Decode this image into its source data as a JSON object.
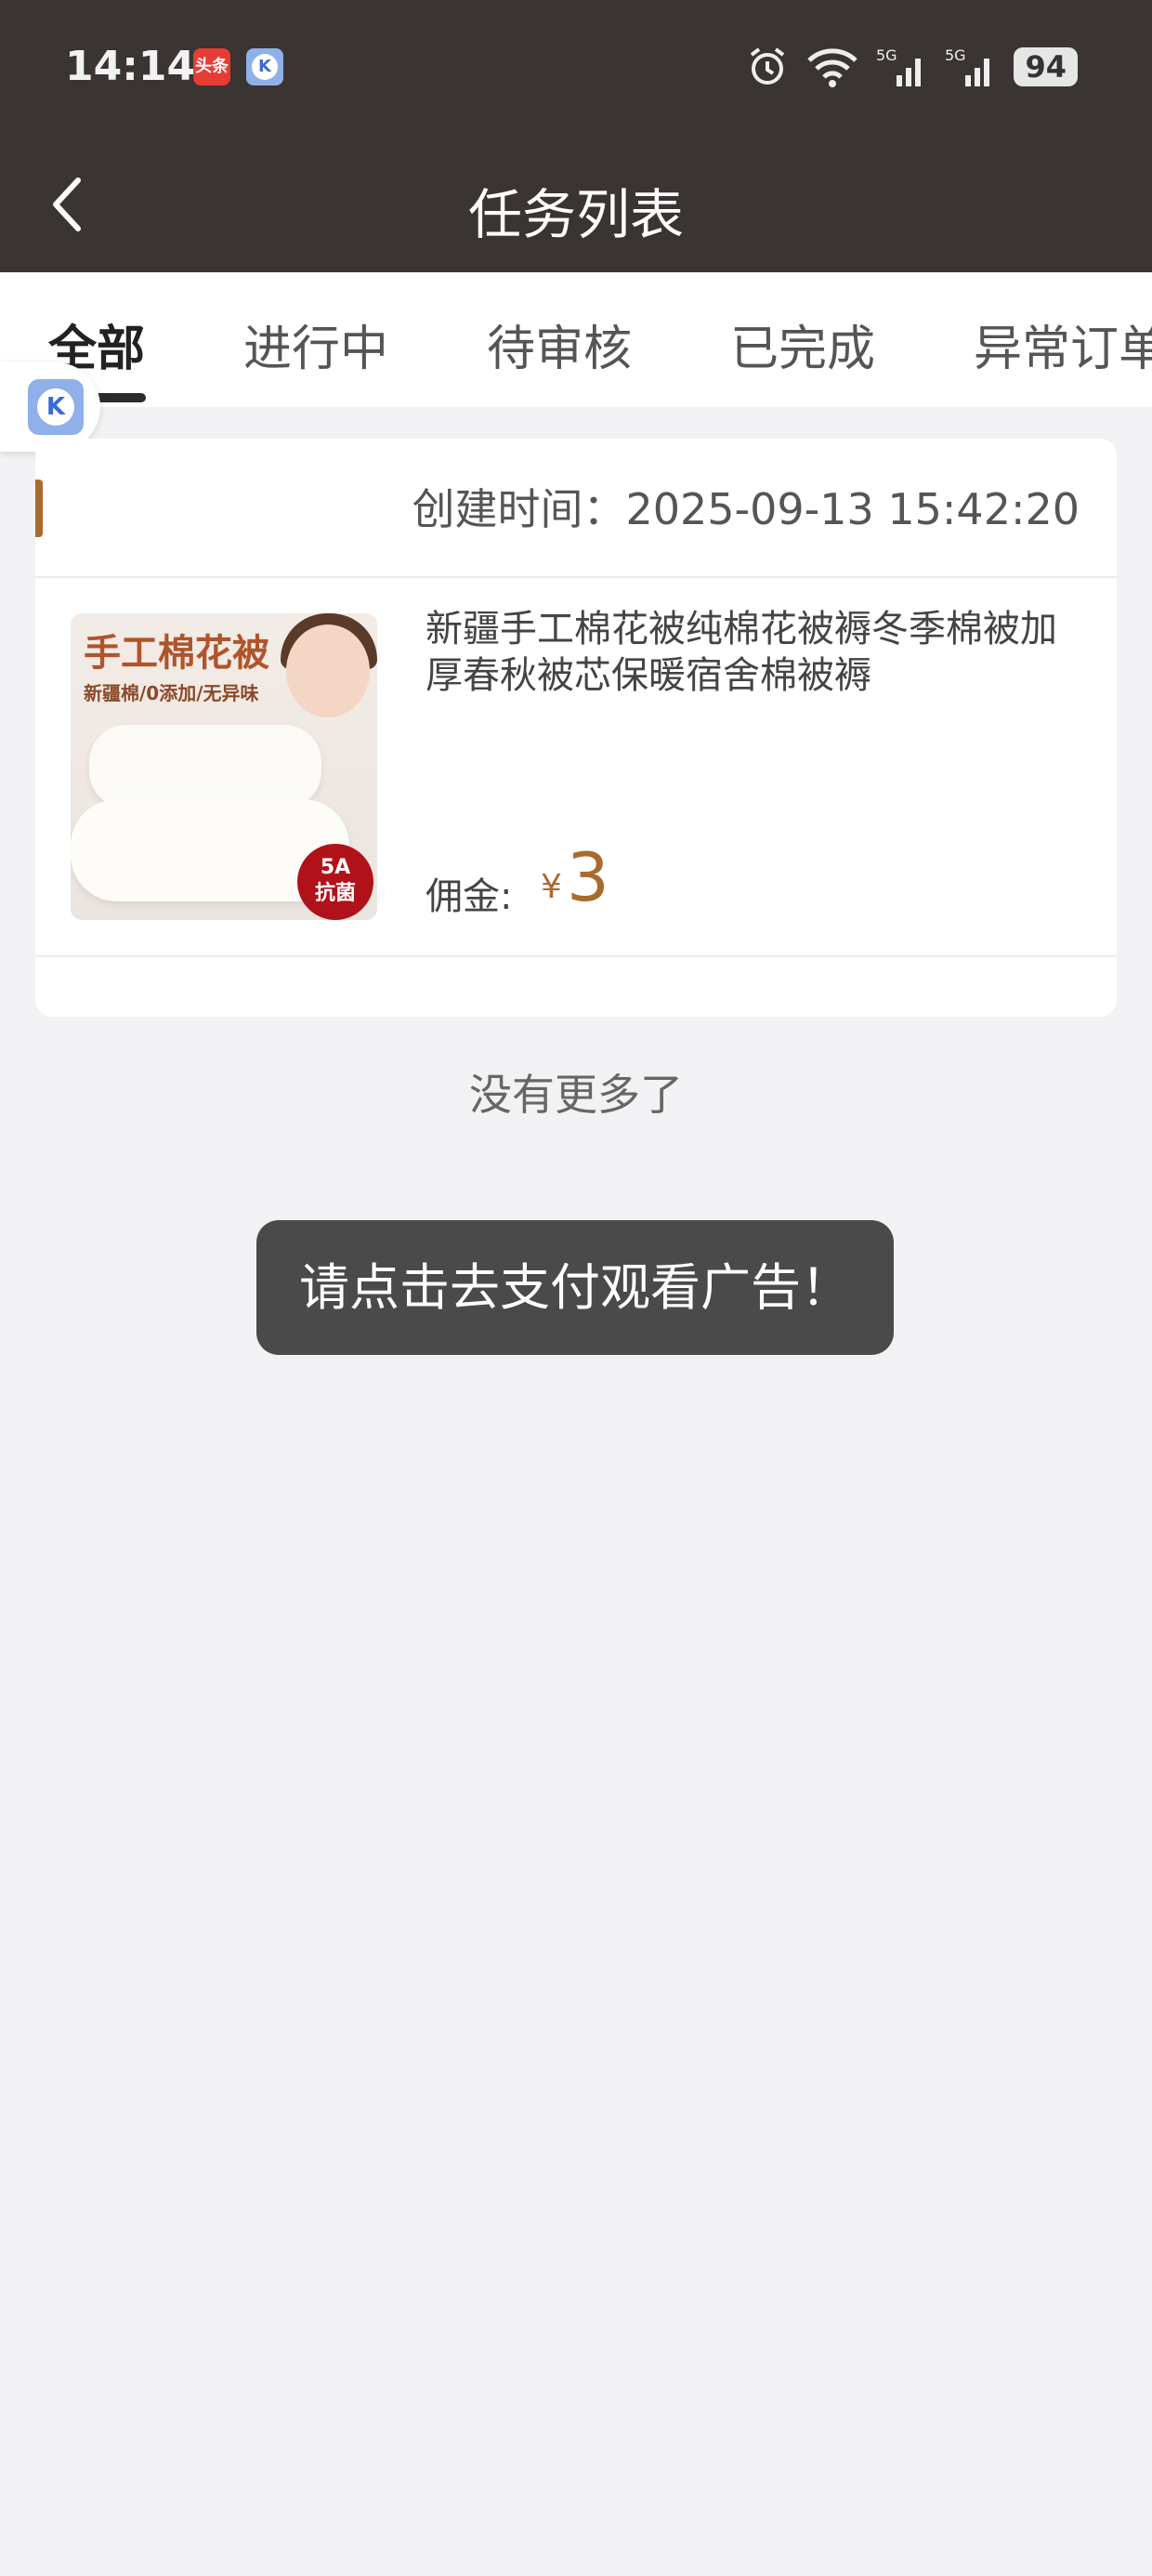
{
  "status_bar": {
    "time": "14:14",
    "app_icons": [
      "toutiao-icon",
      "k-app-icon"
    ],
    "toutiao_label": "头条",
    "k_label": "K",
    "network_1": "5G",
    "network_2": "5G",
    "battery": "94"
  },
  "header": {
    "title": "任务列表",
    "background": "#3a3432"
  },
  "tabs": [
    {
      "label": "全部",
      "active": true
    },
    {
      "label": "进行中",
      "active": false
    },
    {
      "label": "待审核",
      "active": false
    },
    {
      "label": "已完成",
      "active": false
    },
    {
      "label": "异常订单",
      "active": false
    }
  ],
  "floating_button": {
    "label": "K"
  },
  "task": {
    "created_time": "创建时间：2025-09-13 15:42:20",
    "image_title": "手工棉花被",
    "image_subtitle": "新疆棉/0添加/无异味",
    "image_badge_line1": "5A",
    "image_badge_line2": "抗菌",
    "product_title": "新疆手工棉花被纯棉花被褥冬季棉被加厚春秋被芯保暖宿舍棉被褥",
    "commission_label": "佣金:",
    "currency": "¥",
    "commission_value": "3",
    "accent_color": "#a86a2f"
  },
  "list_end_text": "没有更多了",
  "toast": "请点击去支付观看广告！"
}
